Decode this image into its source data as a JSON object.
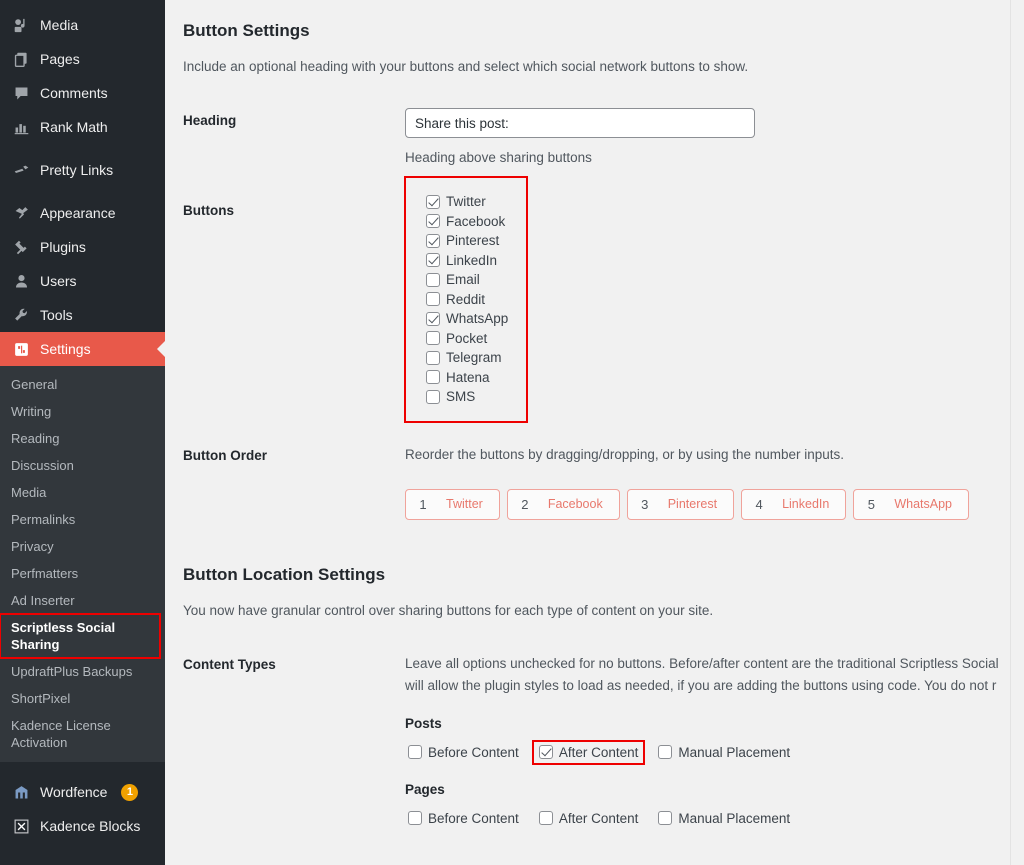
{
  "sidebar": {
    "top_items": [
      {
        "label": "Media",
        "icon": "media-icon"
      },
      {
        "label": "Pages",
        "icon": "pages-icon"
      },
      {
        "label": "Comments",
        "icon": "comments-icon"
      },
      {
        "label": "Rank Math",
        "icon": "rank-math-icon"
      },
      {
        "label": "Pretty Links",
        "icon": "pretty-links-icon"
      },
      {
        "label": "Appearance",
        "icon": "appearance-icon"
      },
      {
        "label": "Plugins",
        "icon": "plugins-icon"
      },
      {
        "label": "Users",
        "icon": "users-icon"
      },
      {
        "label": "Tools",
        "icon": "tools-icon"
      }
    ],
    "active_item": {
      "label": "Settings",
      "icon": "settings-icon"
    },
    "submenu": [
      {
        "label": "General",
        "current": false,
        "highlighted": false
      },
      {
        "label": "Writing",
        "current": false,
        "highlighted": false
      },
      {
        "label": "Reading",
        "current": false,
        "highlighted": false
      },
      {
        "label": "Discussion",
        "current": false,
        "highlighted": false
      },
      {
        "label": "Media",
        "current": false,
        "highlighted": false
      },
      {
        "label": "Permalinks",
        "current": false,
        "highlighted": false
      },
      {
        "label": "Privacy",
        "current": false,
        "highlighted": false
      },
      {
        "label": "Perfmatters",
        "current": false,
        "highlighted": false
      },
      {
        "label": "Ad Inserter",
        "current": false,
        "highlighted": false
      },
      {
        "label": "Scriptless Social Sharing",
        "current": true,
        "highlighted": true
      },
      {
        "label": "UpdraftPlus Backups",
        "current": false,
        "highlighted": false
      },
      {
        "label": "ShortPixel",
        "current": false,
        "highlighted": false
      },
      {
        "label": "Kadence License Activation",
        "current": false,
        "highlighted": false
      }
    ],
    "bottom_items": [
      {
        "label": "Wordfence",
        "icon": "wordfence-icon",
        "badge": "1"
      },
      {
        "label": "Kadence Blocks",
        "icon": "kadence-blocks-icon",
        "badge": ""
      }
    ]
  },
  "button_settings": {
    "title": "Button Settings",
    "description": "Include an optional heading with your buttons and select which social network buttons to show.",
    "heading_label": "Heading",
    "heading_value": "Share this post:",
    "heading_help": "Heading above sharing buttons",
    "buttons_label": "Buttons",
    "networks": [
      {
        "label": "Twitter",
        "checked": true
      },
      {
        "label": "Facebook",
        "checked": true
      },
      {
        "label": "Pinterest",
        "checked": true
      },
      {
        "label": "LinkedIn",
        "checked": true
      },
      {
        "label": "Email",
        "checked": false
      },
      {
        "label": "Reddit",
        "checked": false
      },
      {
        "label": "WhatsApp",
        "checked": true
      },
      {
        "label": "Pocket",
        "checked": false
      },
      {
        "label": "Telegram",
        "checked": false
      },
      {
        "label": "Hatena",
        "checked": false
      },
      {
        "label": "SMS",
        "checked": false
      }
    ],
    "order_label": "Button Order",
    "order_desc": "Reorder the buttons by dragging/dropping, or by using the number inputs.",
    "order_chips": [
      {
        "num": "1",
        "name": "Twitter"
      },
      {
        "num": "2",
        "name": "Facebook"
      },
      {
        "num": "3",
        "name": "Pinterest"
      },
      {
        "num": "4",
        "name": "LinkedIn"
      },
      {
        "num": "5",
        "name": "WhatsApp"
      }
    ]
  },
  "location_settings": {
    "title": "Button Location Settings",
    "description": "You now have granular control over sharing buttons for each type of content on your site.",
    "content_types_label": "Content Types",
    "content_types_desc_line1": "Leave all options unchecked for no buttons. Before/after content are the traditional Scriptless Social",
    "content_types_desc_line2": "will allow the plugin styles to load as needed, if you are adding the buttons using code. You do not r",
    "posts_label": "Posts",
    "posts_options": [
      {
        "label": "Before Content",
        "checked": false,
        "highlighted": false
      },
      {
        "label": "After Content",
        "checked": true,
        "highlighted": true
      },
      {
        "label": "Manual Placement",
        "checked": false,
        "highlighted": false
      }
    ],
    "pages_label": "Pages",
    "pages_options": [
      {
        "label": "Before Content",
        "checked": false,
        "highlighted": false
      },
      {
        "label": "After Content",
        "checked": false,
        "highlighted": false
      },
      {
        "label": "Manual Placement",
        "checked": false,
        "highlighted": false
      }
    ]
  },
  "colors": {
    "sidebar_bg": "#23282d",
    "submenu_bg": "#32373c",
    "active_red": "#e8594a",
    "annotation_red": "#ee0000",
    "chip_border": "#f0a39b",
    "chip_text": "#e8786c",
    "badge_orange": "#f0a100",
    "content_bg": "#f1f1f1"
  }
}
